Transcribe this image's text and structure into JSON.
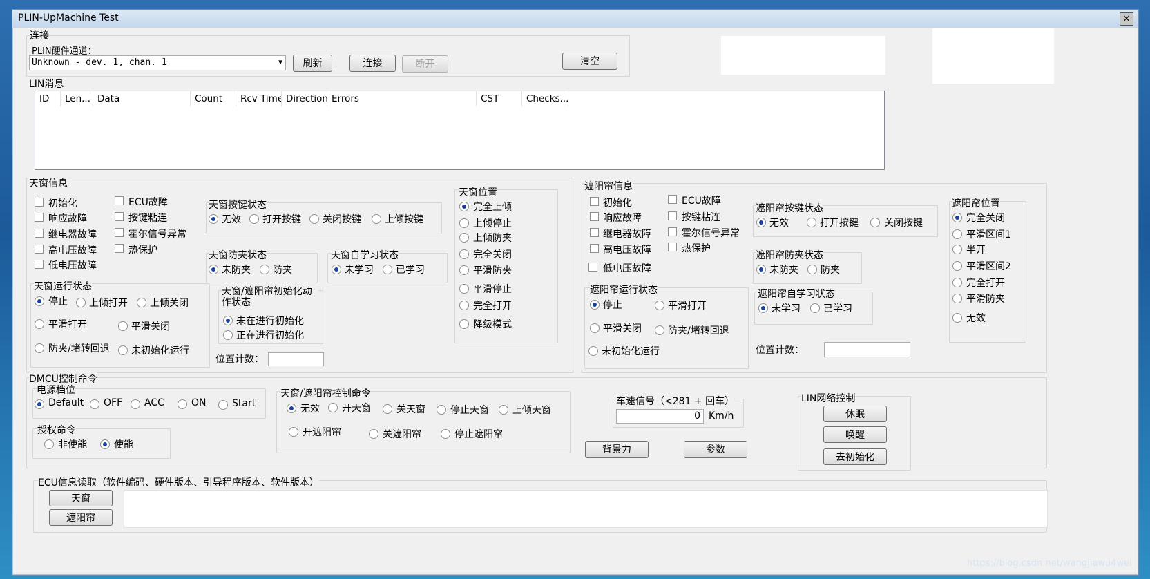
{
  "window": {
    "title": "PLIN-UpMachine Test",
    "close": "×"
  },
  "connect": {
    "group": "连接",
    "hw_label": "PLIN硬件通道：",
    "hw_value": "Unknown - dev. 1, chan. 1",
    "refresh": "刷新",
    "connect": "连接",
    "disconnect": "断开",
    "clear": "清空"
  },
  "lin": {
    "group": "LIN消息",
    "columns": [
      "ID",
      "Len...",
      "Data",
      "Count",
      "Rcv Time",
      "Direction",
      "Errors",
      "CST",
      "Checks..."
    ]
  },
  "sunroof": {
    "group": "天窗信息",
    "faults_col1": [
      "初始化",
      "响应故障",
      "继电器故障",
      "高电压故障",
      "低电压故障"
    ],
    "faults_col2": [
      "ECU故障",
      "按键粘连",
      "霍尔信号异常",
      "热保护"
    ],
    "key_group": "天窗按键状态",
    "key_opts": [
      "无效",
      "打开按键",
      "关闭按键",
      "上倾按键"
    ],
    "pinch_group": "天窗防夹状态",
    "pinch_opts": [
      "未防夹",
      "防夹"
    ],
    "learn_group": "天窗自学习状态",
    "learn_opts": [
      "未学习",
      "已学习"
    ],
    "run_group": "天窗运行状态",
    "run_opts": [
      "停止",
      "上倾打开",
      "上倾关闭",
      "平滑打开",
      "平滑关闭",
      "防夹/堵转回退",
      "未初始化运行"
    ],
    "init_group": "天窗/遮阳帘初始化动作状态",
    "init_opts": [
      "未在进行初始化",
      "正在进行初始化"
    ],
    "pos_count": "位置计数：",
    "pos_group": "天窗位置",
    "pos_opts": [
      "完全上倾",
      "上倾停止",
      "上倾防夹",
      "完全关闭",
      "平滑防夹",
      "平滑停止",
      "完全打开",
      "降级模式"
    ]
  },
  "shade": {
    "group": "遮阳帘信息",
    "faults_col1": [
      "初始化",
      "响应故障",
      "继电器故障",
      "高电压故障",
      "低电压故障"
    ],
    "faults_col2": [
      "ECU故障",
      "按键粘连",
      "霍尔信号异常",
      "热保护"
    ],
    "key_group": "遮阳帘按键状态",
    "key_opts": [
      "无效",
      "打开按键",
      "关闭按键"
    ],
    "pinch_group": "遮阳帘防夹状态",
    "pinch_opts": [
      "未防夹",
      "防夹"
    ],
    "learn_group": "遮阳帘自学习状态",
    "learn_opts": [
      "未学习",
      "已学习"
    ],
    "run_group": "遮阳帘运行状态",
    "run_opts": [
      "停止",
      "平滑打开",
      "平滑关闭",
      "防夹/堵转回退",
      "未初始化运行"
    ],
    "pos_count": "位置计数：",
    "pos_group": "遮阳帘位置",
    "pos_opts": [
      "完全关闭",
      "平滑区间1",
      "半开",
      "平滑区间2",
      "完全打开",
      "平滑防夹",
      "无效"
    ]
  },
  "dmcu": {
    "group": "DMCU控制命令",
    "power_group": "电源档位",
    "power_opts": [
      "Default",
      "OFF",
      "ACC",
      "ON",
      "Start"
    ],
    "auth_group": "授权命令",
    "auth_opts": [
      "非使能",
      "使能"
    ],
    "ctrl_group": "天窗/遮阳帘控制命令",
    "ctrl_opts": [
      "无效",
      "开天窗",
      "关天窗",
      "停止天窗",
      "上倾天窗",
      "开遮阳帘",
      "关遮阳帘",
      "停止遮阳帘"
    ],
    "speed_group": "车速信号（<281 + 回车）",
    "speed_value": "0",
    "speed_unit": "Km/h",
    "backlight": "背景力",
    "params": "参数",
    "lin_group": "LIN网络控制",
    "sleep": "休眠",
    "wake": "唤醒",
    "deinit": "去初始化"
  },
  "ecu": {
    "group": "ECU信息读取（软件编码、硬件版本、引导程序版本、软件版本）",
    "sunroof_btn": "天窗",
    "shade_btn": "遮阳帘"
  },
  "watermark": "https://blog.csdn.net/wangjiawu4wei"
}
